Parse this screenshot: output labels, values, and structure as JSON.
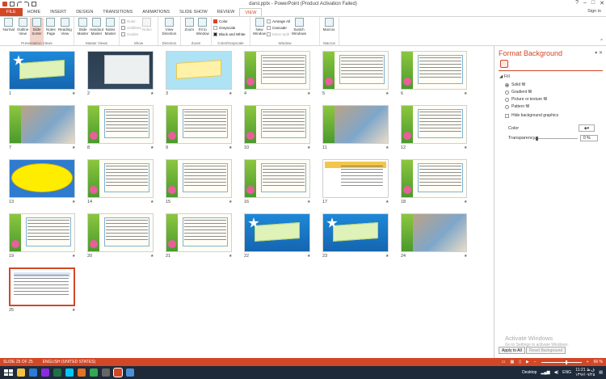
{
  "window": {
    "title": "darsl.pptx - PowerPoint (Product Activation Failed)",
    "signin": "Sign in"
  },
  "tabs": [
    {
      "label": "FILE"
    },
    {
      "label": "HOME"
    },
    {
      "label": "INSERT"
    },
    {
      "label": "DESIGN"
    },
    {
      "label": "TRANSITIONS"
    },
    {
      "label": "ANIMATIONS"
    },
    {
      "label": "SLIDE SHOW"
    },
    {
      "label": "REVIEW"
    },
    {
      "label": "VIEW"
    }
  ],
  "ribbon": {
    "presentation_views": {
      "label": "Presentation Views",
      "buttons": [
        "Normal",
        "Outline View",
        "Slide Sorter",
        "Notes Page",
        "Reading View"
      ]
    },
    "master_views": {
      "label": "Master Views",
      "buttons": [
        "Slide Master",
        "Handout Master",
        "Notes Master"
      ]
    },
    "show": {
      "label": "Show",
      "items": [
        "Ruler",
        "Gridlines",
        "Guides"
      ],
      "notes": "Notes"
    },
    "direction": {
      "label": "Direction",
      "button": "View Direction"
    },
    "zoom": {
      "label": "Zoom",
      "buttons": [
        "Zoom",
        "Fit to Window"
      ]
    },
    "color": {
      "label": "Color/Grayscale",
      "items": [
        "Color",
        "Grayscale",
        "Black and White"
      ]
    },
    "window": {
      "label": "Window",
      "new_window": "New Window",
      "items": [
        "Arrange All",
        "Cascade",
        "Move Split"
      ],
      "switch": "Switch Windows"
    },
    "macros": {
      "label": "Macros",
      "button": "Macros"
    }
  },
  "slides": [
    {
      "num": "1"
    },
    {
      "num": "2"
    },
    {
      "num": "3"
    },
    {
      "num": "4"
    },
    {
      "num": "5"
    },
    {
      "num": "6"
    },
    {
      "num": "7"
    },
    {
      "num": "8"
    },
    {
      "num": "9"
    },
    {
      "num": "10"
    },
    {
      "num": "11"
    },
    {
      "num": "12"
    },
    {
      "num": "13"
    },
    {
      "num": "14"
    },
    {
      "num": "15"
    },
    {
      "num": "16"
    },
    {
      "num": "17"
    },
    {
      "num": "18"
    },
    {
      "num": "19"
    },
    {
      "num": "20"
    },
    {
      "num": "21"
    },
    {
      "num": "22"
    },
    {
      "num": "23"
    },
    {
      "num": "24"
    },
    {
      "num": "25"
    }
  ],
  "pane": {
    "title": "Format Background",
    "fill_header": "Fill",
    "options": [
      "Solid fill",
      "Gradient fill",
      "Picture or texture fill",
      "Pattern fill"
    ],
    "selected_option": "Solid fill",
    "hide_graphics": "Hide background graphics",
    "color_label": "Color",
    "transparency_label": "Transparency",
    "transparency_value": "0 %",
    "apply_all": "Apply to All",
    "reset": "Reset Background"
  },
  "activate": {
    "line1": "Activate Windows",
    "line2": "Go to Settings to activate Windows."
  },
  "status": {
    "slide": "SLIDE 25 OF 25",
    "language": "ENGLISH (UNITED STATES)",
    "zoom": "66 %"
  },
  "taskbar": {
    "desktop": "Desktop",
    "lang": "ENG",
    "time": "11:21 ق.ظ",
    "date": "۱۳۹۶/۰۷/۲۵"
  },
  "colors": {
    "accent": "#d24726",
    "taskbar": "#1e2a3a"
  }
}
